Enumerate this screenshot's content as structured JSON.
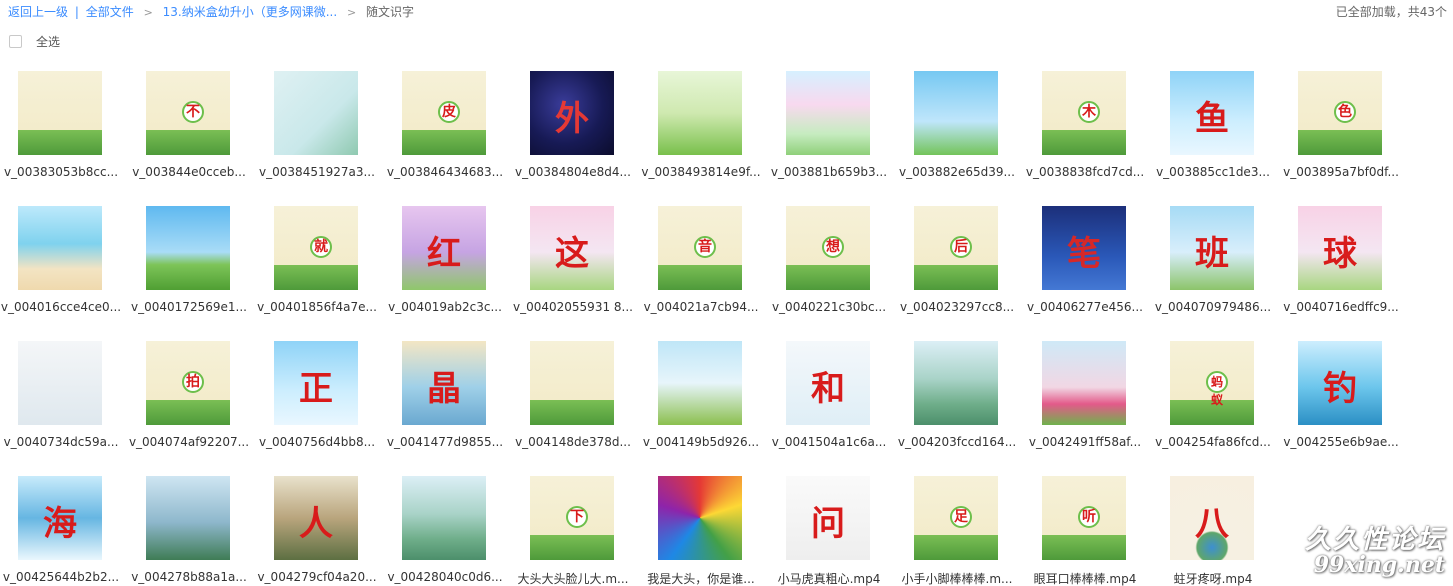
{
  "breadcrumb": {
    "back": "返回上一级",
    "separator": "|",
    "all_files": "全部文件",
    "arrow": ">",
    "folder": "13.纳米盒幼升小（更多网课微...",
    "current": "随文识字"
  },
  "status": "已全部加载，共43个",
  "select_all": "全选",
  "watermark": {
    "line1": "久久性论坛",
    "line2": "99xing.net"
  },
  "files": [
    {
      "name": "v_00383053b8cc...",
      "theme": "book-tree",
      "glyph": ""
    },
    {
      "name": "v_003844e0cceb...",
      "theme": "book-tree",
      "glyph": "不"
    },
    {
      "name": "v_0038451927a3...",
      "theme": "fairy",
      "glyph": ""
    },
    {
      "name": "v_003846434683...",
      "theme": "book-tree",
      "glyph": "皮"
    },
    {
      "name": "v_00384804e8d4...",
      "theme": "space",
      "glyph": "外"
    },
    {
      "name": "v_0038493814e9f...",
      "theme": "green-frog",
      "glyph": ""
    },
    {
      "name": "v_003881b659b3...",
      "theme": "rainbow",
      "glyph": ""
    },
    {
      "name": "v_003882e65d39...",
      "theme": "kids-sky",
      "glyph": ""
    },
    {
      "name": "v_0038838fcd7cd...",
      "theme": "book-tree",
      "glyph": "木"
    },
    {
      "name": "v_003885cc1de3...",
      "theme": "sky-sun",
      "glyph": "鱼"
    },
    {
      "name": "v_003895a7bf0df...",
      "theme": "book-tree",
      "glyph": "色"
    },
    {
      "name": "v_004016cce4ce0...",
      "theme": "beach",
      "glyph": ""
    },
    {
      "name": "v_0040172569e1...",
      "theme": "meadow",
      "glyph": ""
    },
    {
      "name": "v_00401856f4a7e...",
      "theme": "book-tree",
      "glyph": "就"
    },
    {
      "name": "v_004019ab2c3c...",
      "theme": "purple-flower",
      "glyph": "红"
    },
    {
      "name": "v_00402055931 8...",
      "theme": "pink-flower",
      "glyph": "这"
    },
    {
      "name": "v_004021a7cb94...",
      "theme": "book-tree",
      "glyph": "音"
    },
    {
      "name": "v_0040221c30bc...",
      "theme": "book-tree",
      "glyph": "想"
    },
    {
      "name": "v_004023297cc8...",
      "theme": "book-tree",
      "glyph": "后"
    },
    {
      "name": "v_00406277e456...",
      "theme": "night-star",
      "glyph": "笔"
    },
    {
      "name": "v_004070979486...",
      "theme": "school",
      "glyph": "班"
    },
    {
      "name": "v_0040716edffc9...",
      "theme": "pink-flower",
      "glyph": "球"
    },
    {
      "name": "v_0040734dc59a...",
      "theme": "city-sketch",
      "glyph": ""
    },
    {
      "name": "v_004074af92207...",
      "theme": "book-tree",
      "glyph": "拍"
    },
    {
      "name": "v_0040756d4bb8...",
      "theme": "sky-sun",
      "glyph": "正"
    },
    {
      "name": "v_0041477d9855...",
      "theme": "princess",
      "glyph": "晶"
    },
    {
      "name": "v_004148de378d...",
      "theme": "book-tree",
      "glyph": ""
    },
    {
      "name": "v_004149b5d926...",
      "theme": "mouse",
      "glyph": ""
    },
    {
      "name": "v_0041504a1c6a...",
      "theme": "teacher",
      "glyph": "和"
    },
    {
      "name": "v_004203fccd164...",
      "theme": "mountain",
      "glyph": ""
    },
    {
      "name": "v_0042491ff58af...",
      "theme": "tulip",
      "glyph": ""
    },
    {
      "name": "v_004254fa86fcd...",
      "theme": "book-tree",
      "glyph": "蚂蚁"
    },
    {
      "name": "v_004255e6b9ae...",
      "theme": "sea",
      "glyph": "钓"
    },
    {
      "name": "v_00425644b2b2...",
      "theme": "wave",
      "glyph": "海"
    },
    {
      "name": "v_004278b88a1a...",
      "theme": "statue",
      "glyph": ""
    },
    {
      "name": "v_004279cf04a20...",
      "theme": "village",
      "glyph": "人"
    },
    {
      "name": "v_00428040c0d6...",
      "theme": "mountain",
      "glyph": ""
    },
    {
      "name": "大头大头脸儿大.m...",
      "theme": "book-tree",
      "glyph": "下"
    },
    {
      "name": "我是大头，你是谁...",
      "theme": "burst",
      "glyph": ""
    },
    {
      "name": "小马虎真粗心.mp4",
      "theme": "teacher-white",
      "glyph": "问"
    },
    {
      "name": "小手小脚棒棒棒.m...",
      "theme": "book-tree",
      "glyph": "足"
    },
    {
      "name": "眼耳口棒棒棒.mp4",
      "theme": "book-tree",
      "glyph": "听"
    },
    {
      "name": "蛀牙疼呀.mp4",
      "theme": "globe",
      "glyph": "八"
    }
  ]
}
